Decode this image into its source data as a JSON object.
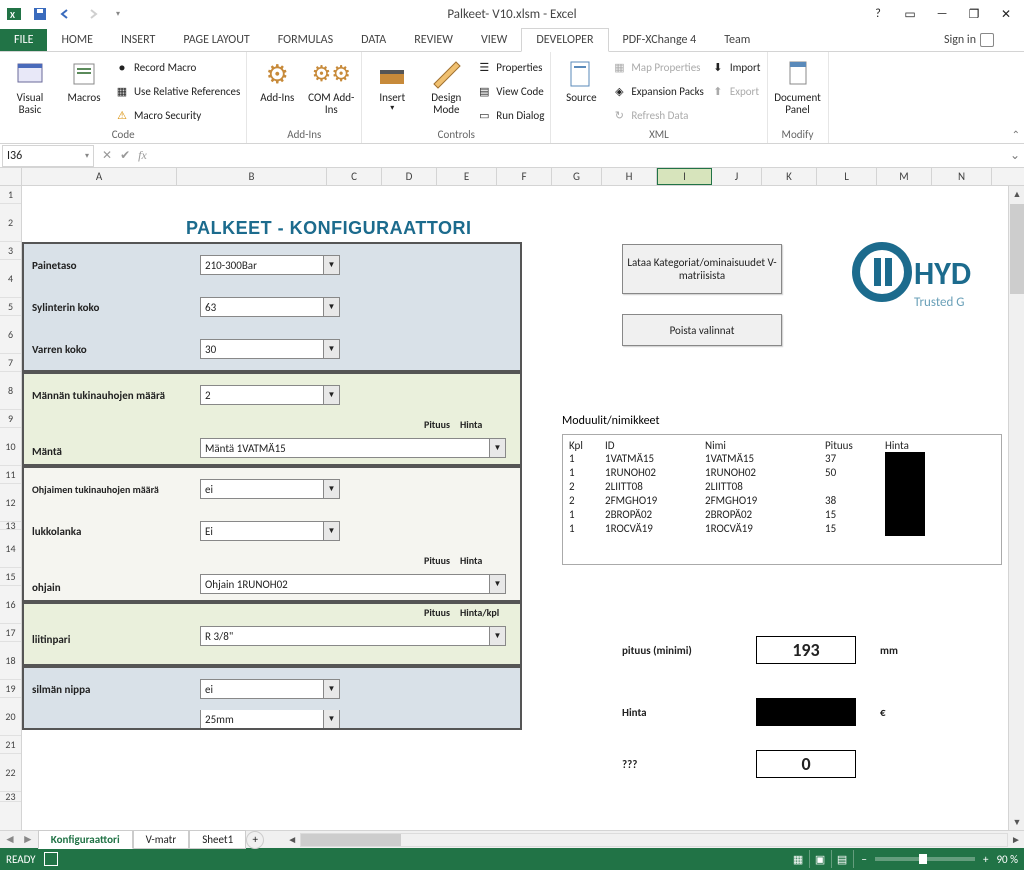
{
  "titlebar": {
    "title": "Palkeet- V10.xlsm - Excel"
  },
  "window_controls": {
    "help": "?",
    "ribbon_opts": "▭",
    "min": "—",
    "max": "❐",
    "close": "✕"
  },
  "tabs": {
    "file": "FILE",
    "home": "HOME",
    "insert": "INSERT",
    "pagelayout": "PAGE LAYOUT",
    "formulas": "FORMULAS",
    "data": "DATA",
    "review": "REVIEW",
    "view": "VIEW",
    "developer": "DEVELOPER",
    "pdf": "PDF-XChange 4",
    "team": "Team"
  },
  "signin": "Sign in",
  "ribbon": {
    "code": {
      "visual_basic": "Visual Basic",
      "macros": "Macros",
      "record": "Record Macro",
      "relrefs": "Use Relative References",
      "security": "Macro Security",
      "group": "Code"
    },
    "addins": {
      "addins": "Add-Ins",
      "com": "COM Add-Ins",
      "group": "Add-Ins"
    },
    "controls": {
      "insert": "Insert",
      "design": "Design Mode",
      "props": "Properties",
      "viewcode": "View Code",
      "rundialog": "Run Dialog",
      "group": "Controls"
    },
    "xml": {
      "source": "Source",
      "mapprops": "Map Properties",
      "expansion": "Expansion Packs",
      "refresh": "Refresh Data",
      "import": "Import",
      "export": "Export",
      "group": "XML"
    },
    "modify": {
      "docpanel": "Document Panel",
      "group": "Modify"
    }
  },
  "namebox": "I36",
  "columns": [
    "A",
    "B",
    "C",
    "D",
    "E",
    "F",
    "G",
    "H",
    "I",
    "J",
    "K",
    "L",
    "M",
    "N"
  ],
  "rows": [
    "1",
    "2",
    "3",
    "4",
    "5",
    "6",
    "7",
    "8",
    "9",
    "10",
    "11",
    "12",
    "13",
    "14",
    "15",
    "16",
    "17",
    "18",
    "19",
    "20",
    "21",
    "22",
    "23"
  ],
  "config_title": "PALKEET - KONFIGURAATTORI",
  "form": {
    "painetaso": {
      "label": "Painetaso",
      "value": "210-300Bar"
    },
    "sylinterin": {
      "label": "Sylinterin koko",
      "value": "63"
    },
    "varren": {
      "label": "Varren koko",
      "value": "30"
    },
    "mannan_tuki": {
      "label": "Männän tukinauhojen määrä",
      "value": "2"
    },
    "pituus_hdr": "Pituus",
    "hinta_hdr": "Hinta",
    "manta": {
      "label": "Mäntä",
      "value": "Mäntä 1VATMÄ15"
    },
    "ohjaimen_tuki": {
      "label": "Ohjaimen tukinauhojen määrä",
      "value": "ei"
    },
    "lukkolanka": {
      "label": "lukkolanka",
      "value": "Ei"
    },
    "ohjain": {
      "label": "ohjain",
      "value": "Ohjain 1RUNOH02"
    },
    "hinta_kpl_hdr": "Hinta/kpl",
    "liitinpari": {
      "label": "liitinpari",
      "value": "R 3/8\""
    },
    "silman_nippa": {
      "label": "silmän nippa",
      "value": "ei"
    },
    "extra": {
      "value": "25mm"
    }
  },
  "buttons": {
    "load": "Lataa Kategoriat/ominaisuudet V-matriisista",
    "clear": "Poista valinnat"
  },
  "mod_title": "Moduulit/nimikkeet",
  "mod_head": {
    "kpl": "Kpl",
    "id": "ID",
    "nimi": "Nimi",
    "pituus": "Pituus",
    "hinta": "Hinta"
  },
  "mod_rows": [
    {
      "kpl": "1",
      "id": "1VATMÄ15",
      "nimi": "1VATMÄ15",
      "pituus": "37"
    },
    {
      "kpl": "1",
      "id": "1RUNOH02",
      "nimi": "1RUNOH02",
      "pituus": "50"
    },
    {
      "kpl": "2",
      "id": "2LIITT08",
      "nimi": "2LIITT08",
      "pituus": ""
    },
    {
      "kpl": "2",
      "id": "2FMGHO19",
      "nimi": "2FMGHO19",
      "pituus": "38"
    },
    {
      "kpl": "1",
      "id": "2BROPÄ02",
      "nimi": "2BROPÄ02",
      "pituus": "15"
    },
    {
      "kpl": "1",
      "id": "1ROCVÄ19",
      "nimi": "1ROCVÄ19",
      "pituus": "15"
    }
  ],
  "summary": {
    "pituus_label": "pituus (minimi)",
    "pituus_value": "193",
    "pituus_unit": "mm",
    "hinta_label": "Hinta",
    "hinta_unit": "€",
    "q_label": "???",
    "q_value": "0"
  },
  "sheet_tabs": {
    "konfig": "Konfiguraattori",
    "vmatr": "V-matr",
    "sheet1": "Sheet1"
  },
  "status": {
    "ready": "READY",
    "zoom": "90 %"
  },
  "logo": {
    "brand": "HYD",
    "tag": "Trusted G"
  }
}
